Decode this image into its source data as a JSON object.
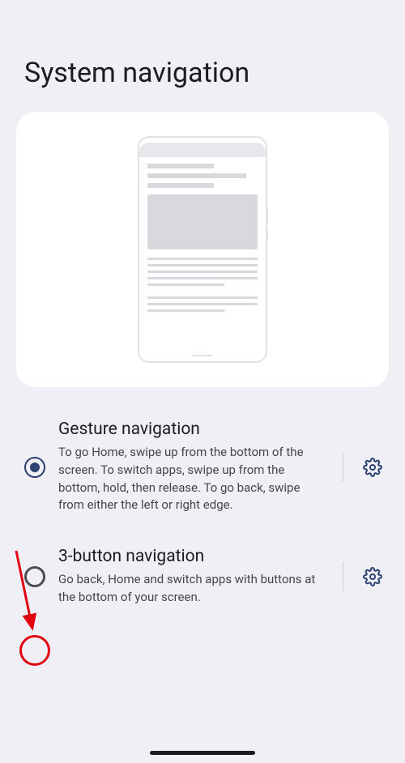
{
  "page_title": "System navigation",
  "options": [
    {
      "title": "Gesture navigation",
      "description": "To go Home, swipe up from the bottom of the screen. To switch apps, swipe up from the bottom, hold, then release. To go back, swipe from either the left or right edge.",
      "selected": true
    },
    {
      "title": "3-button navigation",
      "description": "Go back, Home and switch apps with buttons at the bottom of your screen.",
      "selected": false
    }
  ],
  "colors": {
    "accent": "#2b4273",
    "highlight": "#e3000f"
  }
}
